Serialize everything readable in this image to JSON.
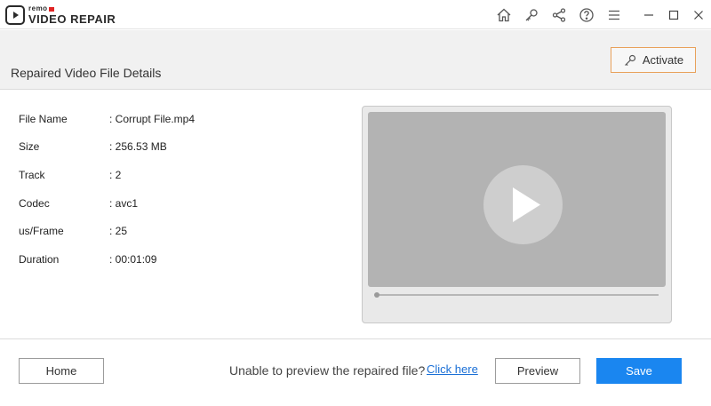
{
  "app": {
    "brand": "remo",
    "product": "VIDEO REPAIR"
  },
  "header": {
    "title": "Repaired Video File Details",
    "activate_label": "Activate"
  },
  "details": [
    {
      "key": "File Name",
      "value": ": Corrupt File.mp4"
    },
    {
      "key": "Size",
      "value": ": 256.53 MB"
    },
    {
      "key": "Track",
      "value": ": 2"
    },
    {
      "key": "Codec",
      "value": ": avc1"
    },
    {
      "key": "us/Frame",
      "value": ": 25"
    },
    {
      "key": "Duration",
      "value": ": 00:01:09"
    }
  ],
  "player": {
    "progress": 0
  },
  "footer": {
    "home_label": "Home",
    "unable_text": "Unable to preview the repaired file?",
    "click_here": "Click here",
    "preview_label": "Preview",
    "save_label": "Save"
  },
  "colors": {
    "accent": "#1a86f0",
    "activate_border": "#e8a15a",
    "link": "#1a6fd6"
  },
  "icons": [
    "home-icon",
    "key-icon",
    "share-icon",
    "help-icon",
    "menu-icon",
    "minimize-icon",
    "maximize-icon",
    "close-icon",
    "play-icon"
  ]
}
